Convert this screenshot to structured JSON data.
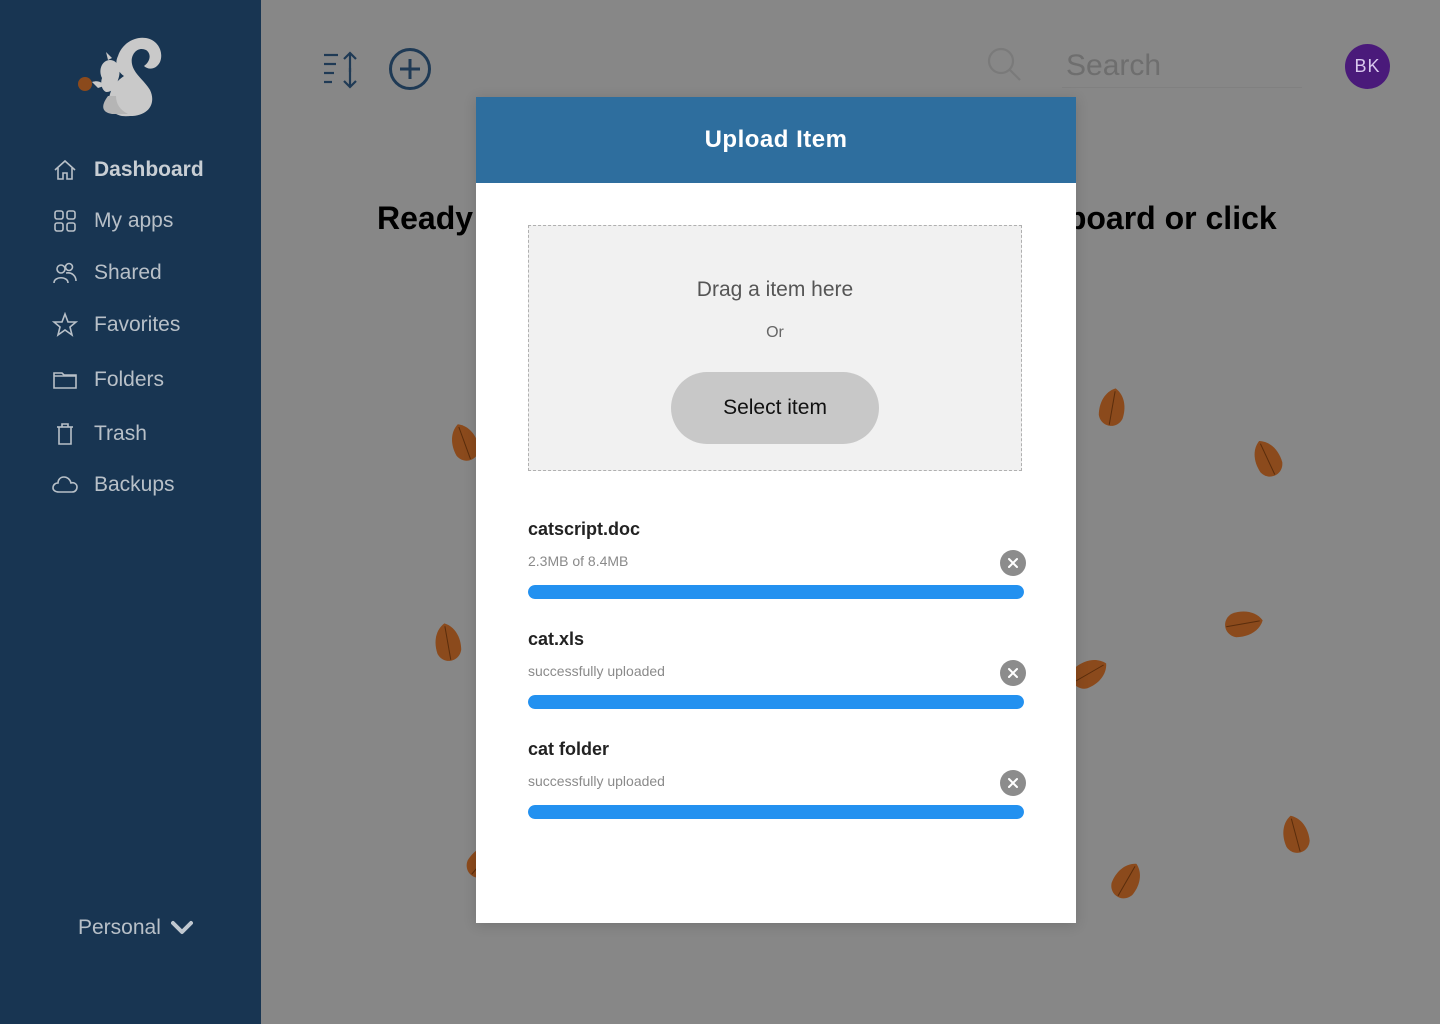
{
  "sidebar": {
    "items": [
      {
        "label": "Dashboard",
        "icon": "home-icon"
      },
      {
        "label": "My apps",
        "icon": "apps-grid-icon"
      },
      {
        "label": "Shared",
        "icon": "people-icon"
      },
      {
        "label": "Favorites",
        "icon": "star-icon"
      },
      {
        "label": "Folders",
        "icon": "folder-icon"
      },
      {
        "label": "Trash",
        "icon": "trash-icon"
      },
      {
        "label": "Backups",
        "icon": "cloud-icon"
      }
    ],
    "account_label": "Personal",
    "logo": "squirrel-logo"
  },
  "header": {
    "search_placeholder": "Search",
    "avatar_initials": "BK"
  },
  "hero": {
    "text": "Ready to upload? Drag an item onto the dashboard or click"
  },
  "modal": {
    "title": "Upload Item",
    "dropzone": {
      "title": "Drag a item here",
      "or": "Or",
      "button_label": "Select item"
    },
    "files": [
      {
        "name": "catscript.doc",
        "status": "2.3MB of 8.4MB",
        "progress": 1.0
      },
      {
        "name": "cat.xls",
        "status": "successfully uploaded",
        "progress": 1.0
      },
      {
        "name": "cat folder",
        "status": "successfully uploaded",
        "progress": 1.0
      }
    ]
  },
  "colors": {
    "sidebar_bg": "#183552",
    "modal_header": "#2e6e9e",
    "progress": "#2391f0",
    "avatar": "#4a1a7a",
    "acorn": "#8b4a1c"
  }
}
